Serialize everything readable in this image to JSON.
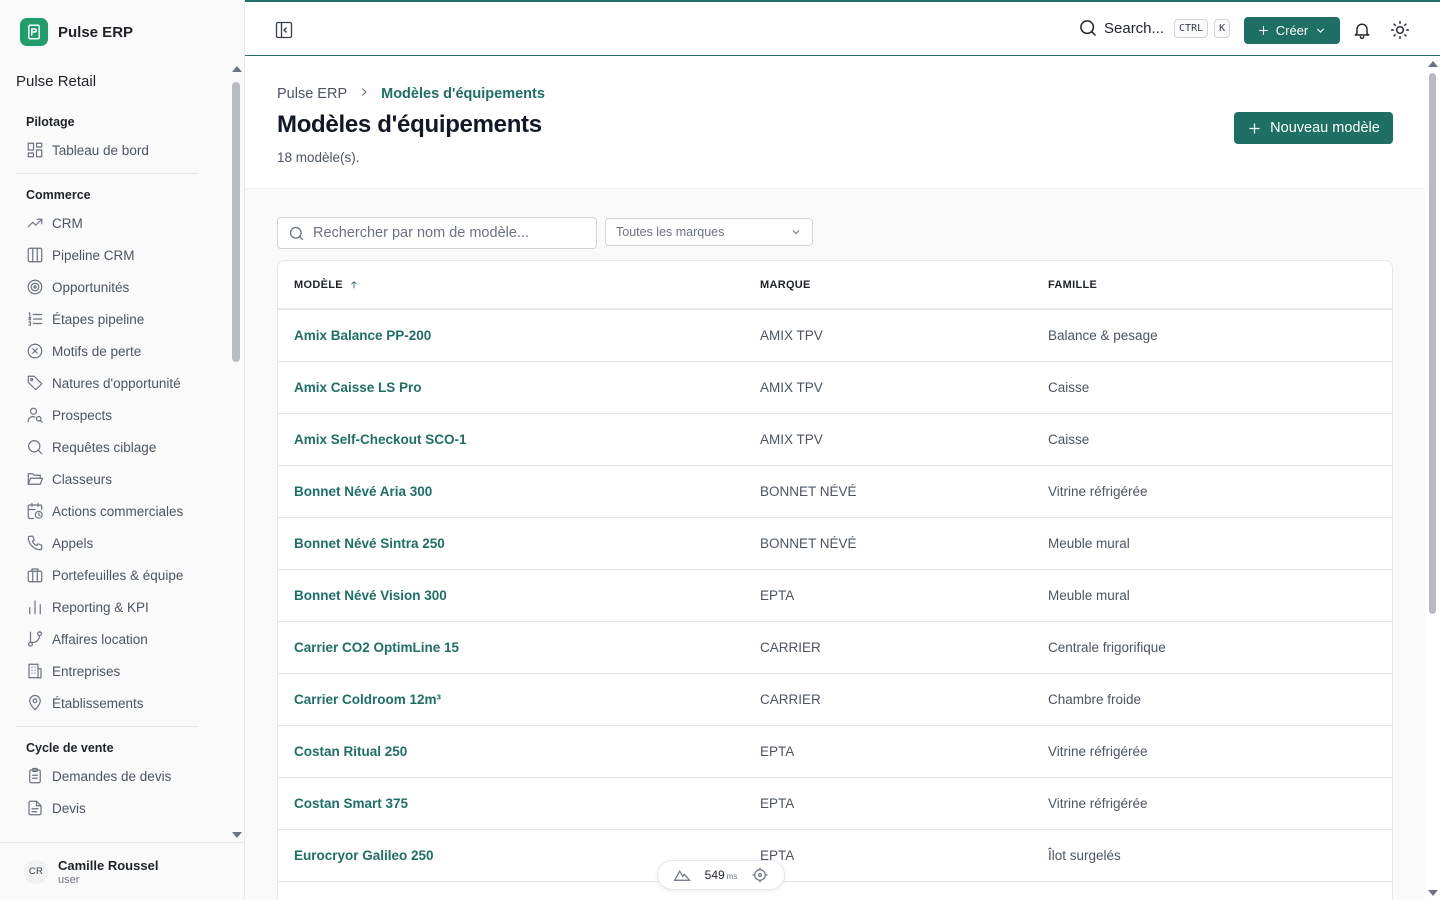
{
  "app": {
    "name": "Pulse ERP",
    "org": "Pulse Retail"
  },
  "sidebar": {
    "groups": [
      {
        "title": "Pilotage",
        "items": [
          {
            "label": "Tableau de bord",
            "icon": "dashboard-icon"
          }
        ]
      },
      {
        "title": "Commerce",
        "items": [
          {
            "label": "CRM",
            "icon": "trending-up-icon"
          },
          {
            "label": "Pipeline CRM",
            "icon": "kanban-icon"
          },
          {
            "label": "Opportunités",
            "icon": "target-icon"
          },
          {
            "label": "Étapes pipeline",
            "icon": "list-ordered-icon"
          },
          {
            "label": "Motifs de perte",
            "icon": "x-circle-icon"
          },
          {
            "label": "Natures d'opportunité",
            "icon": "tag-icon"
          },
          {
            "label": "Prospects",
            "icon": "user-search-icon"
          },
          {
            "label": "Requêtes ciblage",
            "icon": "search-icon"
          },
          {
            "label": "Classeurs",
            "icon": "folder-open-icon"
          },
          {
            "label": "Actions commerciales",
            "icon": "calendar-clock-icon"
          },
          {
            "label": "Appels",
            "icon": "phone-icon"
          },
          {
            "label": "Portefeuilles & équipe",
            "icon": "briefcase-icon"
          },
          {
            "label": "Reporting & KPI",
            "icon": "bar-chart-icon"
          },
          {
            "label": "Affaires location",
            "icon": "git-branch-icon"
          },
          {
            "label": "Entreprises",
            "icon": "building-icon"
          },
          {
            "label": "Établissements",
            "icon": "map-pin-icon"
          }
        ]
      },
      {
        "title": "Cycle de vente",
        "items": [
          {
            "label": "Demandes de devis",
            "icon": "clipboard-icon"
          },
          {
            "label": "Devis",
            "icon": "file-text-icon"
          }
        ]
      }
    ]
  },
  "user": {
    "initials": "CR",
    "name": "Camille Roussel",
    "role": "user"
  },
  "topbar": {
    "search_label": "Search...",
    "kbd_ctrl": "CTRL",
    "kbd_k": "K",
    "create_label": "Créer"
  },
  "page": {
    "breadcrumb_root": "Pulse ERP",
    "breadcrumb_current": "Modèles d'équipements",
    "title": "Modèles d'équipements",
    "count": "18 modèle(s).",
    "new_button": "Nouveau modèle",
    "search_placeholder": "Rechercher par nom de modèle...",
    "brand_filter": "Toutes les marques",
    "accent_color": "#1e6f64"
  },
  "table": {
    "columns": {
      "model": "MODÈLE",
      "brand": "MARQUE",
      "family": "FAMILLE"
    },
    "sort": "model-ascending",
    "rows": [
      {
        "model": "Amix Balance PP-200",
        "brand": "AMIX TPV",
        "family": "Balance & pesage"
      },
      {
        "model": "Amix Caisse LS Pro",
        "brand": "AMIX TPV",
        "family": "Caisse"
      },
      {
        "model": "Amix Self-Checkout SCO-1",
        "brand": "AMIX TPV",
        "family": "Caisse"
      },
      {
        "model": "Bonnet Névé Aria 300",
        "brand": "BONNET NÉVÉ",
        "family": "Vitrine réfrigérée"
      },
      {
        "model": "Bonnet Névé Sintra 250",
        "brand": "BONNET NÉVÉ",
        "family": "Meuble mural"
      },
      {
        "model": "Bonnet Névé Vision 300",
        "brand": "EPTA",
        "family": "Meuble mural"
      },
      {
        "model": "Carrier CO2 OptimLine 15",
        "brand": "CARRIER",
        "family": "Centrale frigorifique"
      },
      {
        "model": "Carrier Coldroom 12m³",
        "brand": "CARRIER",
        "family": "Chambre froide"
      },
      {
        "model": "Costan Ritual 250",
        "brand": "EPTA",
        "family": "Vitrine réfrigérée"
      },
      {
        "model": "Costan Smart 375",
        "brand": "EPTA",
        "family": "Vitrine réfrigérée"
      },
      {
        "model": "Eurocryor Galileo 250",
        "brand": "EPTA",
        "family": "Îlot surgelés"
      }
    ]
  },
  "perf": {
    "value": "549",
    "unit": "ms"
  }
}
